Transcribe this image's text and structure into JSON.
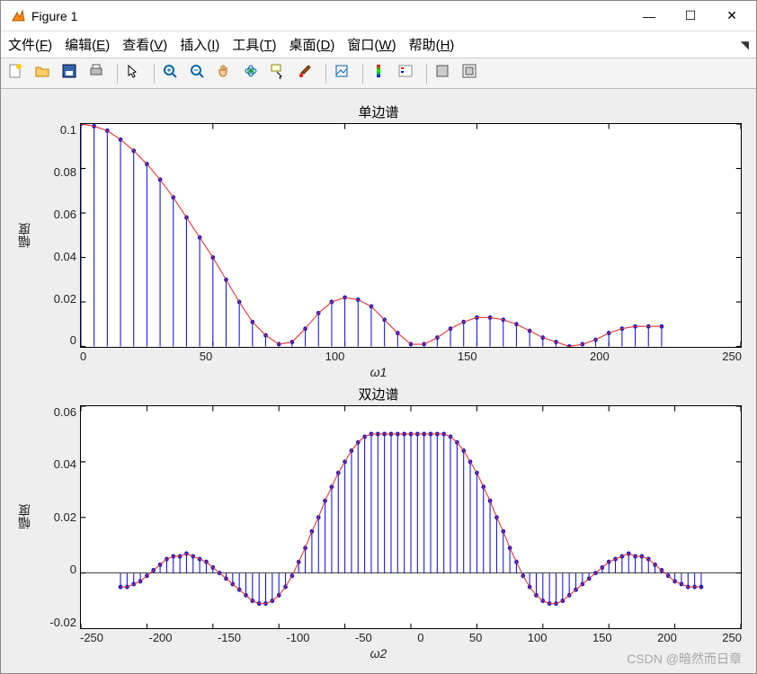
{
  "window": {
    "title": "Figure 1",
    "minimize": "—",
    "maximize": "☐",
    "close": "✕"
  },
  "menu": {
    "file": "文件(F)",
    "edit": "编辑(E)",
    "view": "查看(V)",
    "insert": "插入(I)",
    "tools": "工具(T)",
    "desktop": "桌面(D)",
    "window": "窗口(W)",
    "help": "帮助(H)"
  },
  "toolbar_icons": {
    "new": "new-icon",
    "open": "open-icon",
    "save": "save-icon",
    "print": "print-icon",
    "pointer": "pointer-icon",
    "zoomin": "zoom-in-icon",
    "zoomout": "zoom-out-icon",
    "pan": "pan-icon",
    "rotate": "rotate-icon",
    "datacursor": "datacursor-icon",
    "brush": "brush-icon",
    "link": "link-icon",
    "colorbar": "colorbar-icon",
    "legend": "legend-icon",
    "hide": "hide-icon",
    "axes": "axes-icon"
  },
  "watermark": "CSDN @暗然而日章",
  "chart_data": [
    {
      "type": "stem",
      "title": "单边谱",
      "xlabel": "ω1",
      "ylabel": "幅度",
      "xlim": [
        0,
        250
      ],
      "ylim": [
        0,
        0.1
      ],
      "xticks": [
        0,
        50,
        100,
        150,
        200,
        250
      ],
      "yticks": [
        0,
        0.02,
        0.04,
        0.06,
        0.08,
        0.1
      ],
      "x": [
        0,
        5,
        10,
        15,
        20,
        25,
        30,
        35,
        40,
        45,
        50,
        55,
        60,
        65,
        70,
        75,
        80,
        85,
        90,
        95,
        100,
        105,
        110,
        115,
        120,
        125,
        130,
        135,
        140,
        145,
        150,
        155,
        160,
        165,
        170,
        175,
        180,
        185,
        190,
        195,
        200,
        205,
        210,
        215,
        220
      ],
      "y": [
        0.1,
        0.099,
        0.097,
        0.093,
        0.088,
        0.082,
        0.075,
        0.067,
        0.058,
        0.049,
        0.04,
        0.03,
        0.02,
        0.011,
        0.005,
        0.001,
        0.002,
        0.008,
        0.015,
        0.02,
        0.022,
        0.021,
        0.018,
        0.012,
        0.006,
        0.001,
        0.001,
        0.004,
        0.008,
        0.011,
        0.013,
        0.013,
        0.012,
        0.01,
        0.007,
        0.004,
        0.002,
        0.0,
        0.001,
        0.003,
        0.006,
        0.008,
        0.009,
        0.009,
        0.009
      ]
    },
    {
      "type": "stem",
      "title": "双边谱",
      "xlabel": "ω2",
      "ylabel": "幅度",
      "xlim": [
        -250,
        250
      ],
      "ylim": [
        -0.02,
        0.06
      ],
      "xticks": [
        -250,
        -200,
        -150,
        -100,
        -50,
        0,
        50,
        100,
        150,
        200,
        250
      ],
      "yticks": [
        -0.02,
        0,
        0.02,
        0.04,
        0.06
      ],
      "x": [
        -220,
        -215,
        -210,
        -205,
        -200,
        -195,
        -190,
        -185,
        -180,
        -175,
        -170,
        -165,
        -160,
        -155,
        -150,
        -145,
        -140,
        -135,
        -130,
        -125,
        -120,
        -115,
        -110,
        -105,
        -100,
        -95,
        -90,
        -85,
        -80,
        -75,
        -70,
        -65,
        -60,
        -55,
        -50,
        -45,
        -40,
        -35,
        -30,
        -25,
        -20,
        -15,
        -10,
        -5,
        0,
        5,
        10,
        15,
        20,
        25,
        30,
        35,
        40,
        45,
        50,
        55,
        60,
        65,
        70,
        75,
        80,
        85,
        90,
        95,
        100,
        105,
        110,
        115,
        120,
        125,
        130,
        135,
        140,
        145,
        150,
        155,
        160,
        165,
        170,
        175,
        180,
        185,
        190,
        195,
        200,
        205,
        210,
        215,
        220
      ],
      "y": [
        -0.005,
        -0.005,
        -0.004,
        -0.003,
        -0.001,
        0.001,
        0.003,
        0.005,
        0.006,
        0.006,
        0.007,
        0.006,
        0.005,
        0.004,
        0.002,
        0.0,
        -0.002,
        -0.004,
        -0.006,
        -0.008,
        -0.01,
        -0.011,
        -0.011,
        -0.01,
        -0.008,
        -0.005,
        -0.001,
        0.004,
        0.009,
        0.015,
        0.02,
        0.026,
        0.031,
        0.036,
        0.04,
        0.044,
        0.047,
        0.049,
        0.05,
        0.05,
        0.05,
        0.05,
        0.05,
        0.05,
        0.05,
        0.05,
        0.05,
        0.05,
        0.05,
        0.05,
        0.049,
        0.047,
        0.044,
        0.04,
        0.036,
        0.031,
        0.026,
        0.02,
        0.015,
        0.009,
        0.004,
        -0.001,
        -0.005,
        -0.008,
        -0.01,
        -0.011,
        -0.011,
        -0.01,
        -0.008,
        -0.006,
        -0.004,
        -0.002,
        0.0,
        0.002,
        0.004,
        0.005,
        0.006,
        0.007,
        0.006,
        0.006,
        0.005,
        0.003,
        0.001,
        -0.001,
        -0.003,
        -0.004,
        -0.005,
        -0.005,
        -0.005
      ]
    }
  ]
}
